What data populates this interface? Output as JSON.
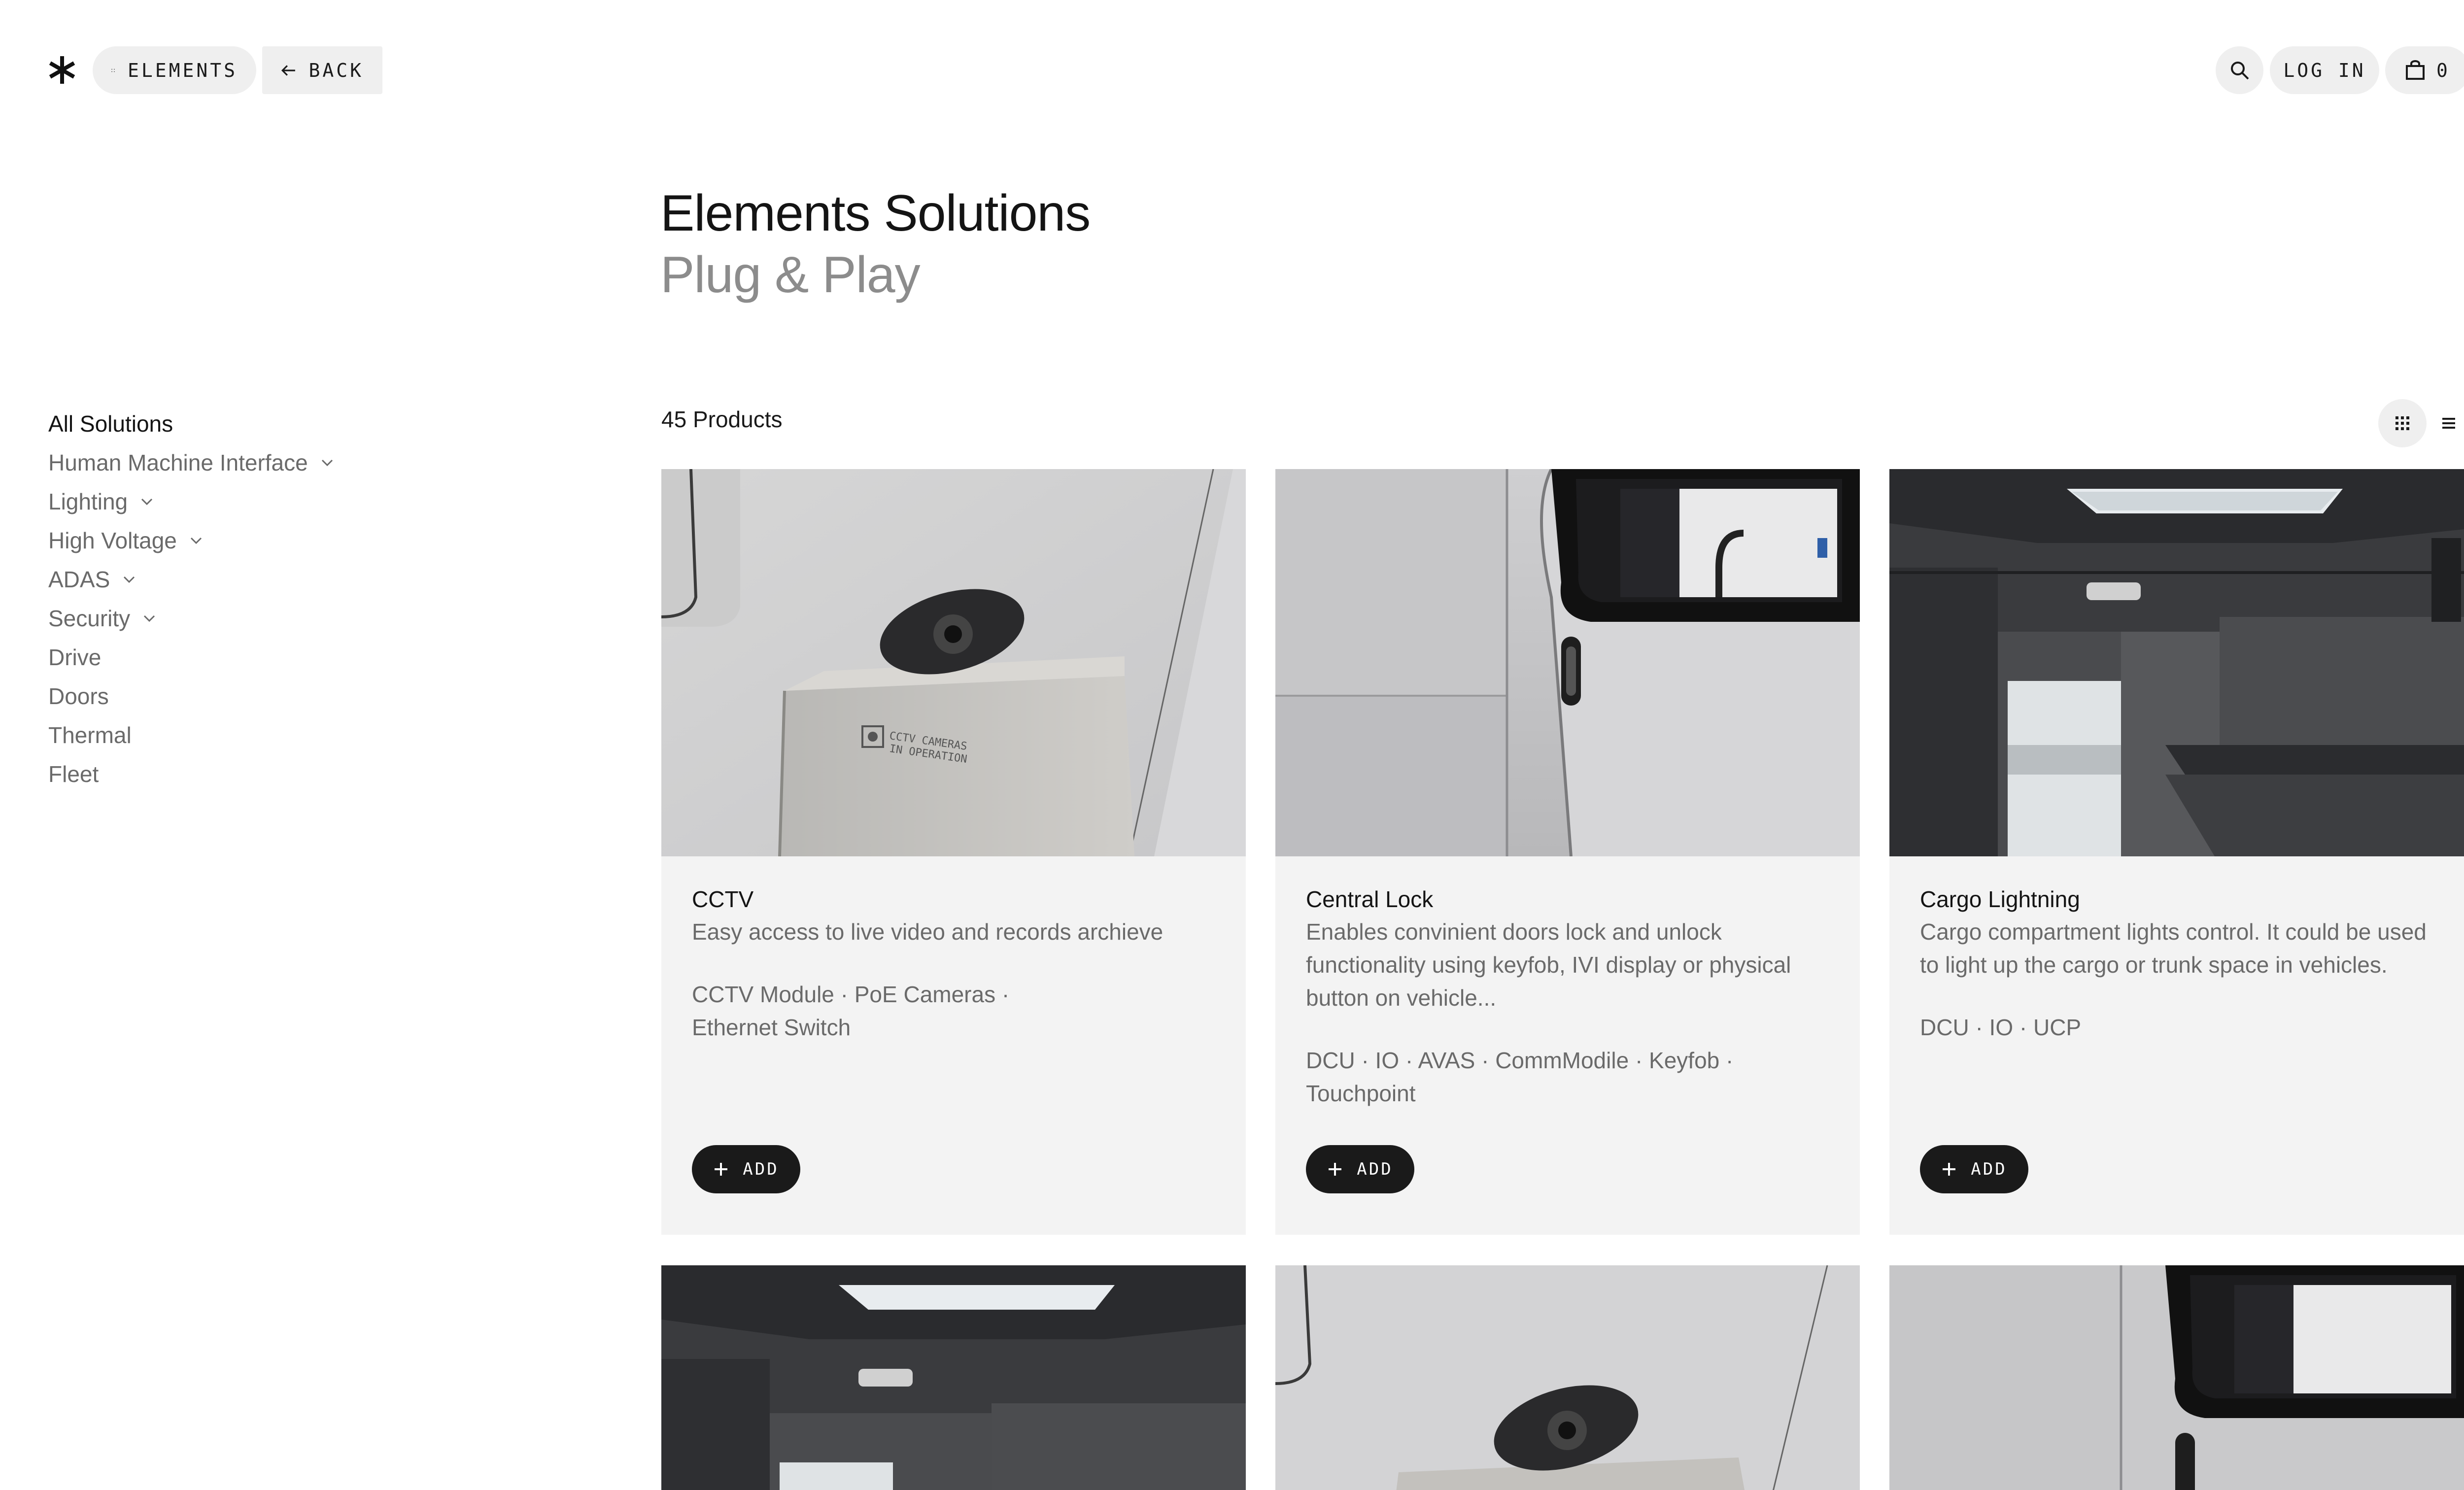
{
  "header": {
    "logo": "asterisk-logo",
    "elements_label": "ELEMENTS",
    "back_label": "BACK",
    "login_label": "LOG IN",
    "cart_count": "0"
  },
  "page": {
    "title": "Elements Solutions",
    "subtitle": "Plug & Play"
  },
  "sidebar": {
    "items": [
      {
        "label": "All Solutions",
        "has_dropdown": false,
        "active": true
      },
      {
        "label": "Human Machine Interface",
        "has_dropdown": true
      },
      {
        "label": "Lighting",
        "has_dropdown": true
      },
      {
        "label": "High Voltage",
        "has_dropdown": true
      },
      {
        "label": "ADAS",
        "has_dropdown": true
      },
      {
        "label": "Security",
        "has_dropdown": true
      },
      {
        "label": "Drive",
        "has_dropdown": false
      },
      {
        "label": "Doors",
        "has_dropdown": false
      },
      {
        "label": "Thermal",
        "has_dropdown": false
      },
      {
        "label": "Fleet",
        "has_dropdown": false
      }
    ]
  },
  "products": {
    "count_label": "45 Products",
    "add_label": "ADD",
    "cards": [
      {
        "title": "CCTV",
        "description": "Easy access to live video and records archieve",
        "tags_line1": "CCTV Module  ·  PoE Cameras  ·",
        "tags_line2": "Ethernet Switch",
        "image": "cctv-camera-photo",
        "image_text_line1": "CCTV CAMERAS",
        "image_text_line2": "IN OPERATION"
      },
      {
        "title": "Central Lock",
        "description": "Enables convinient doors lock and unlock functionality using keyfob, IVI display or physical button on vehicle...",
        "tags_line1": "DCU  ·  IO  ·  AVAS  ·  CommModile  · Keyfob  ·",
        "tags_line2": "Touchpoint",
        "image": "van-door-photo"
      },
      {
        "title": "Cargo Lightning",
        "description": "Cargo compartment lights control. It could be used to light up the cargo or trunk space in vehicles.",
        "tags_line1": "DCU  ·  IO  ·  UCP",
        "tags_line2": "",
        "image": "cargo-interior-photo"
      }
    ]
  },
  "colors": {
    "card_bg": "#f3f3f3",
    "pill_bg": "#efefef",
    "button_dark": "#1a1a1a",
    "muted_text": "#6a6a6a",
    "subtitle": "#8c8c8c"
  }
}
